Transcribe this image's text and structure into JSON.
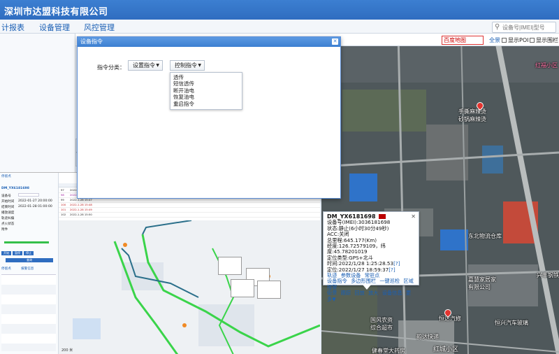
{
  "app": {
    "company": "深圳市达盟科技有限公司"
  },
  "nav": {
    "items": [
      "计报表",
      "设备管理",
      "风控管理"
    ],
    "search_placeholder": "设备号|IMEI|型号"
  },
  "map_toolbar": {
    "map_type": "百度地图",
    "fullscreen": "全景",
    "show_poi": "显示POI",
    "show_fence": "显示围栏"
  },
  "dialog": {
    "title": "设备指令",
    "category_label": "指令分类：",
    "category_value": "设置指令",
    "command_value": "控制指令",
    "menu_items": [
      "透传",
      "短信透传",
      "断开油电",
      "恢复油电",
      "重启指令"
    ]
  },
  "vehicle": {
    "name": "DM_YX6181698",
    "imei": "设备号(IMEI):3036181698",
    "status": "状态:静止(6小时30分49秒)",
    "acc": "ACC:关闭",
    "mileage": "总里程:645.177(Km)",
    "coords": "经度:126.72579109，纬度:45.78201019",
    "positioning": "定位类型:GPS+北斗",
    "time": "时间:2022/1/28 1:25:28.53",
    "time_link": "[?]",
    "fix": "定位:2022/1/27 18:59:37",
    "fix_link": "[?]",
    "links_row1": [
      "轨迹",
      "参数设备",
      "常驻点"
    ],
    "links_row2": [
      "设备指令",
      "多边形围栏",
      "一键巡检",
      "区域报警"
    ],
    "links_row3": [
      "街景",
      "跟踪",
      "回放",
      "放大",
      "设备信息",
      "更多▼"
    ]
  },
  "map_labels": {
    "label1": "手撕麻辣烫\n砂锅麻辣烫",
    "label2": "东北物流仓库",
    "label3": "嘉慧家居家\n有限公司",
    "label4": "兴丰钢铁",
    "label5": "国风农资\n综合超市",
    "label6": "恒达汽修",
    "label7": "恒兴汽车玻璃",
    "label8": "韵达快递",
    "label9": "红城小区",
    "label10": "健春堂大药房",
    "label11": "红福小区"
  },
  "overlay": {
    "device_id": "DM_YX6181698",
    "fields": [
      "设备号",
      "开始时间",
      "结束时间",
      "播放速度",
      "轨迹纠偏",
      "点火状态",
      "附件"
    ],
    "values": [
      "2022-01-27 20:00:00",
      "2022-01-28 01:00:00"
    ],
    "buttons": [
      "查询",
      "导出",
      "开始",
      "暂停",
      "停止"
    ],
    "tabs": [
      "停留点",
      "报警信息"
    ],
    "rows": [
      {
        "n": "97",
        "time": "2022-1-28 15:45"
      },
      {
        "n": "98",
        "time": "2022-1-28 15:46"
      },
      {
        "n": "99",
        "time": "2022-1-28 15:47"
      },
      {
        "n": "100",
        "time": "2022-1-28 15:48"
      },
      {
        "n": "101",
        "time": "2022-1-28 15:49"
      },
      {
        "n": "102",
        "time": "2022-1-28 15:50"
      }
    ],
    "scale": "200 米"
  }
}
